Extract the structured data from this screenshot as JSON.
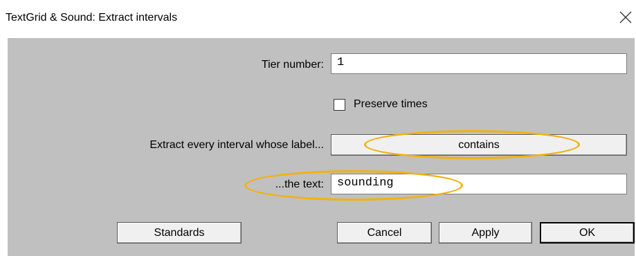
{
  "window": {
    "title": "TextGrid & Sound: Extract intervals",
    "close_icon": "close-icon"
  },
  "form": {
    "tier_number": {
      "label": "Tier number:",
      "value": "1"
    },
    "preserve_times": {
      "label": "Preserve times",
      "checked": false
    },
    "extract_mode": {
      "label": "Extract every interval whose label...",
      "value": "contains"
    },
    "the_text": {
      "label": "...the text:",
      "value": "sounding"
    }
  },
  "buttons": {
    "standards": "Standards",
    "cancel": "Cancel",
    "apply": "Apply",
    "ok": "OK"
  },
  "colors": {
    "dialog_background": "#c0c0c0",
    "highlight_annotation": "#f2b20e"
  }
}
